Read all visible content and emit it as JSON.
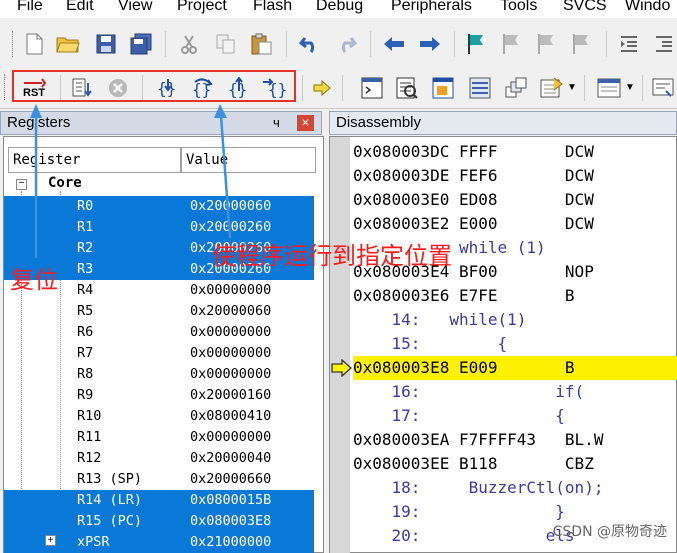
{
  "menu": [
    "File",
    "Edit",
    "View",
    "Project",
    "Flash",
    "Debug",
    "Peripherals",
    "Tools",
    "SVCS",
    "Windo"
  ],
  "toolbar2": {
    "reset_label": "RST"
  },
  "registers": {
    "panel_title": "Registers",
    "pin_glyph": "ч",
    "close_glyph": "×",
    "col_register": "Register",
    "col_value": "Value",
    "group": "Core",
    "items": [
      {
        "name": "R0",
        "value": "0x20000060",
        "selected": true
      },
      {
        "name": "R1",
        "value": "0x20000260",
        "selected": true
      },
      {
        "name": "R2",
        "value": "0x20000260",
        "selected": true
      },
      {
        "name": "R3",
        "value": "0x20000260",
        "selected": true
      },
      {
        "name": "R4",
        "value": "0x00000000",
        "selected": false
      },
      {
        "name": "R5",
        "value": "0x20000060",
        "selected": false
      },
      {
        "name": "R6",
        "value": "0x00000000",
        "selected": false
      },
      {
        "name": "R7",
        "value": "0x00000000",
        "selected": false
      },
      {
        "name": "R8",
        "value": "0x00000000",
        "selected": false
      },
      {
        "name": "R9",
        "value": "0x20000160",
        "selected": false
      },
      {
        "name": "R10",
        "value": "0x08000410",
        "selected": false
      },
      {
        "name": "R11",
        "value": "0x00000000",
        "selected": false
      },
      {
        "name": "R12",
        "value": "0x20000040",
        "selected": false
      },
      {
        "name": "R13 (SP)",
        "value": "0x20000660",
        "selected": false
      },
      {
        "name": "R14 (LR)",
        "value": "0x0800015B",
        "selected": true
      },
      {
        "name": "R15 (PC)",
        "value": "0x080003E8",
        "selected": true
      },
      {
        "name": "xPSR",
        "value": "0x21000000",
        "selected": true
      }
    ]
  },
  "disassembly": {
    "panel_title": "Disassembly",
    "lines": [
      {
        "type": "addr",
        "text": "0x080003DC FFFF       DCW"
      },
      {
        "type": "addr",
        "text": "0x080003DE FEF6       DCW"
      },
      {
        "type": "addr",
        "text": "0x080003E0 ED08       DCW"
      },
      {
        "type": "addr",
        "text": "0x080003E2 E000       DCW"
      },
      {
        "type": "src",
        "text": "           while (1)"
      },
      {
        "type": "addr",
        "text": "0x080003E4 BF00       NOP"
      },
      {
        "type": "addr",
        "text": "0x080003E6 E7FE       B"
      },
      {
        "type": "src",
        "text": "    14:   while(1)"
      },
      {
        "type": "src",
        "text": "    15:        {"
      },
      {
        "type": "addr",
        "text": "0x080003E8 E009       B"
      },
      {
        "type": "src",
        "text": "    16:              if("
      },
      {
        "type": "src",
        "text": "    17:              {"
      },
      {
        "type": "addr",
        "text": "0x080003EA F7FFFF43   BL.W"
      },
      {
        "type": "addr",
        "text": "0x080003EE B118       CBZ"
      },
      {
        "type": "src",
        "text": "    18:     BuzzerCtl(on);"
      },
      {
        "type": "src",
        "text": "    19:              }"
      },
      {
        "type": "src",
        "text": "    20:             els"
      }
    ],
    "current_line_index": 9
  },
  "annotations": {
    "reset": "复位",
    "run_to": "使程序运行到指定位置"
  },
  "watermark": "CSDN @原物奇迹",
  "colors": {
    "selection": "#0a78d7",
    "highlight": "#fff200",
    "annotation": "#ff1a1a"
  }
}
